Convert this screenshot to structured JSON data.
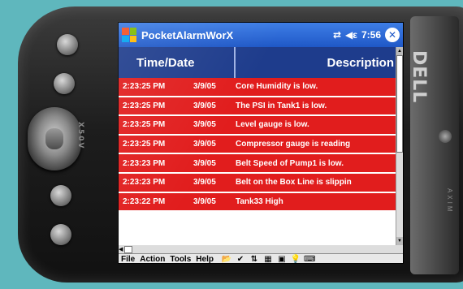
{
  "app": {
    "title": "PocketAlarmWorX",
    "time": "7:56",
    "close_label": "✕"
  },
  "device": {
    "brand": "DELL",
    "model": "X50V",
    "side_text": "AXIM"
  },
  "table": {
    "headers": {
      "time_date": "Time/Date",
      "description": "Description"
    },
    "rows": [
      {
        "time": "2:23:25 PM",
        "date": "3/9/05",
        "description": "Core Humidity is low."
      },
      {
        "time": "2:23:25 PM",
        "date": "3/9/05",
        "description": "The PSI in Tank1 is low."
      },
      {
        "time": "2:23:25 PM",
        "date": "3/9/05",
        "description": "Level gauge is low."
      },
      {
        "time": "2:23:25 PM",
        "date": "3/9/05",
        "description": "Compressor gauge is reading"
      },
      {
        "time": "2:23:23 PM",
        "date": "3/9/05",
        "description": "Belt Speed of Pump1 is low."
      },
      {
        "time": "2:23:23 PM",
        "date": "3/9/05",
        "description": "Belt on the Box Line is slippin"
      },
      {
        "time": "2:23:22 PM",
        "date": "3/9/05",
        "description": "Tank33 High"
      }
    ]
  },
  "menu": {
    "file": "File",
    "action": "Action",
    "tools": "Tools",
    "help": "Help"
  },
  "colors": {
    "alarm_row": "#e11d1d",
    "header": "#1e3c8c",
    "titlebar": "#1f58c7",
    "background": "#5fb7bd"
  }
}
